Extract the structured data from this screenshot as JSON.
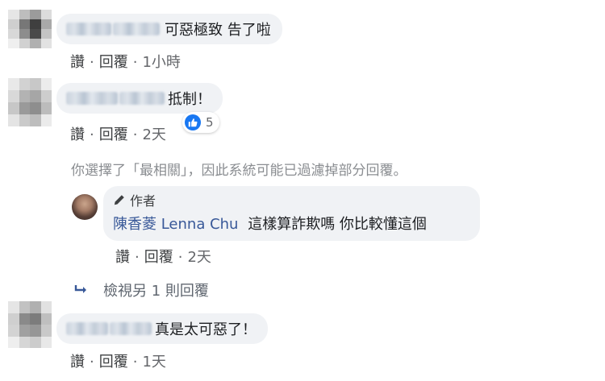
{
  "actions": {
    "like": "讚",
    "reply": "回覆",
    "separator": "·"
  },
  "comments": [
    {
      "text": "可惡極致 告了啦",
      "time": "1小時"
    },
    {
      "text": "抵制！",
      "time": "2天",
      "reaction_count": "5"
    },
    {
      "text": "真是太可惡了！",
      "time": "1天"
    }
  ],
  "filter_notice": "你選擇了「最相關」，因此系統可能已過濾掉部分回覆。",
  "reply": {
    "author_badge": "作者",
    "author_name": "陳香菱 Lenna Chu",
    "text": "這樣算詐欺嗎 你比較懂這個",
    "time": "2天"
  },
  "more_replies": "檢視另 1 則回覆",
  "colors": {
    "link": "#385898",
    "bubble": "#f0f2f5",
    "like_blue": "#1877f2"
  },
  "icons": [
    "pencil-icon",
    "like-icon",
    "reply-arrow-icon"
  ]
}
